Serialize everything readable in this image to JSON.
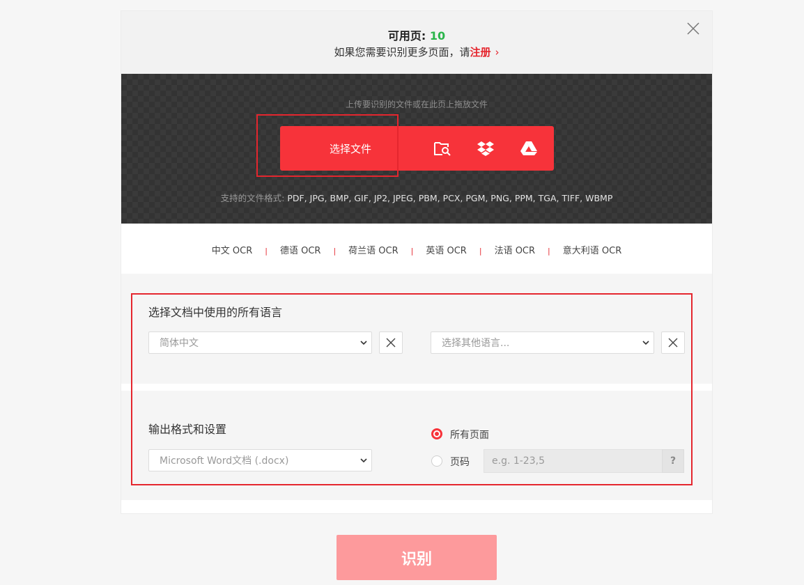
{
  "banner": {
    "available_label": "可用页: ",
    "available_count": "10",
    "more_text": "如果您需要识别更多页面，请",
    "register_link": "注册",
    "arrow": "›"
  },
  "upload": {
    "drag_hint": "上传要识别的文件或在此页上拖放文件",
    "choose_file": "选择文件",
    "formats_label": "支持的文件格式: ",
    "formats_list": "PDF, JPG, BMP, GIF, JP2, JPEG, PBM, PCX, PGM, PNG, PPM, TGA, TIFF, WBMP"
  },
  "ocr_links": [
    "中文 OCR",
    "德语 OCR",
    "荷兰语 OCR",
    "英语 OCR",
    "法语 OCR",
    "意大利语 OCR"
  ],
  "language": {
    "title": "选择文档中使用的所有语言",
    "primary_selected": "简体中文",
    "secondary_placeholder": "选择其他语言..."
  },
  "output": {
    "title": "输出格式和设置",
    "format_selected": "Microsoft Word文档 (.docx)",
    "all_pages_label": "所有页面",
    "page_range_label": "页码",
    "page_range_placeholder": "e.g. 1-23,5",
    "help_label": "?"
  },
  "action": {
    "recognize_label": "识别"
  },
  "colors": {
    "accent": "#f7333a",
    "highlight": "#e5262e",
    "count_green": "#2ab54a",
    "button_disabled": "#fd9a9c"
  }
}
